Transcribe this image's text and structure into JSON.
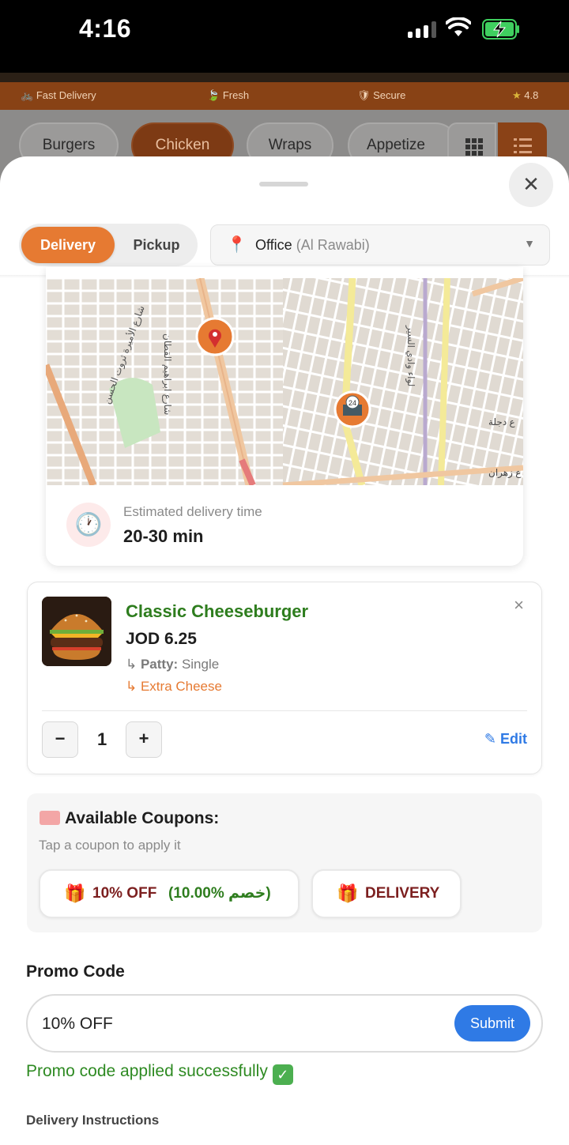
{
  "status_bar": {
    "time": "4:16"
  },
  "background": {
    "trust_badges": [
      "Fast Delivery",
      "Fresh",
      "Secure"
    ],
    "rating": "4.8",
    "categories": [
      "Burgers",
      "Chicken",
      "Wraps",
      "Appetize"
    ],
    "active_category": "Chicken"
  },
  "sheet": {
    "modes": {
      "delivery": "Delivery",
      "pickup": "Pickup",
      "selected": "Delivery"
    },
    "location": {
      "name": "Office",
      "area": "(Al Rawabi)"
    },
    "map": {
      "store_badge": "24"
    },
    "eta": {
      "label": "Estimated delivery time",
      "value": "20-30 min"
    },
    "item": {
      "name": "Classic Cheeseburger",
      "price": "JOD 6.25",
      "mod_label": "Patty:",
      "mod_value": "Single",
      "extra": "Extra Cheese",
      "quantity": "1",
      "minus": "−",
      "plus": "+",
      "edit_label": "Edit",
      "remove": "×"
    },
    "coupons": {
      "title": "Available Coupons:",
      "hint": "Tap a coupon to apply it",
      "list": [
        {
          "code": "10% OFF",
          "arabic": "(10.00% خصم)"
        },
        {
          "code": "DELIVERY"
        }
      ]
    },
    "promo": {
      "title": "Promo Code",
      "value": "10% OFF",
      "submit": "Submit",
      "success": "Promo code applied successfully"
    },
    "instructions_title": "Delivery Instructions"
  },
  "colors": {
    "accent": "#e67a32",
    "item_name": "#2e7d1e",
    "link": "#2f7ae5",
    "coupon_text": "#7c1f1f"
  }
}
